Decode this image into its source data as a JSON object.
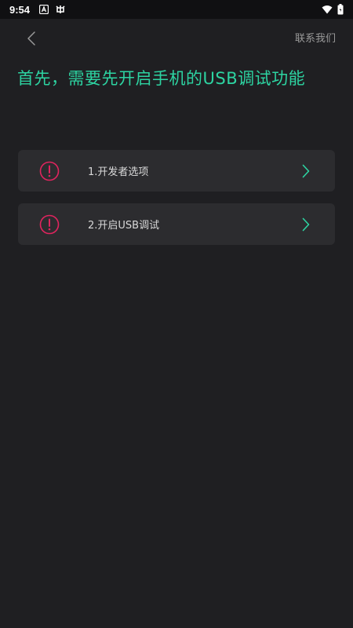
{
  "status_bar": {
    "time": "9:54",
    "left_icons": [
      "notification-a-icon",
      "bug-icon"
    ],
    "right_icons": [
      "wifi-icon",
      "battery-icon"
    ]
  },
  "header": {
    "back_icon": "chevron-left-icon",
    "contact_label": "联系我们"
  },
  "headline": "首先，需要先开启手机的USB调试功能",
  "steps": [
    {
      "label": "1.开发者选项",
      "icon": "alert-circle-icon",
      "chevron": "chevron-right-icon"
    },
    {
      "label": "2.开启USB调试",
      "icon": "alert-circle-icon",
      "chevron": "chevron-right-icon"
    }
  ],
  "colors": {
    "accent": "#2dd4a2",
    "alert": "#e0245e",
    "background": "#1f1f22",
    "card": "#2c2c2f"
  }
}
